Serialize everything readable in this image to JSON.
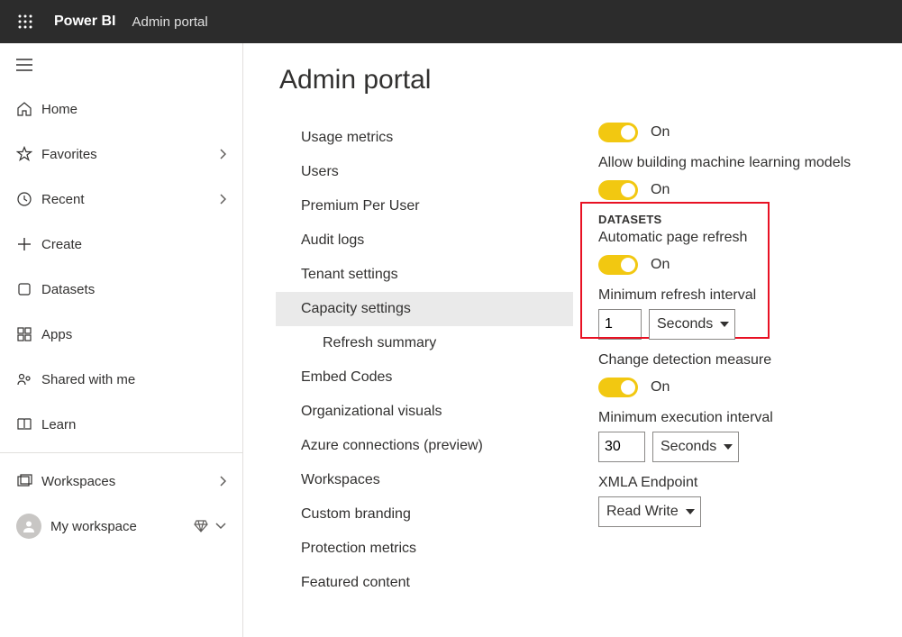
{
  "topbar": {
    "brand": "Power BI",
    "portal": "Admin portal"
  },
  "sidebar": {
    "items": [
      {
        "label": "Home"
      },
      {
        "label": "Favorites"
      },
      {
        "label": "Recent"
      },
      {
        "label": "Create"
      },
      {
        "label": "Datasets"
      },
      {
        "label": "Apps"
      },
      {
        "label": "Shared with me"
      },
      {
        "label": "Learn"
      }
    ],
    "workspaces": "Workspaces",
    "my_workspace": "My workspace"
  },
  "page": {
    "title": "Admin portal"
  },
  "admin_menu": {
    "items": [
      "Usage metrics",
      "Users",
      "Premium Per User",
      "Audit logs",
      "Tenant settings",
      "Capacity settings",
      "Refresh summary",
      "Embed Codes",
      "Organizational visuals",
      "Azure connections (preview)",
      "Workspaces",
      "Custom branding",
      "Protection metrics",
      "Featured content"
    ],
    "selected_index": 5,
    "sub_index": 6
  },
  "settings": {
    "row1_state": "On",
    "allow_ml_label": "Allow building machine learning models",
    "row2_state": "On",
    "section_datasets": "DATASETS",
    "auto_refresh_label": "Automatic page refresh",
    "auto_refresh_state": "On",
    "min_refresh_label": "Minimum refresh interval",
    "min_refresh_value": "1",
    "min_refresh_unit": "Seconds",
    "change_detect_label": "Change detection measure",
    "change_detect_state": "On",
    "min_exec_label": "Minimum execution interval",
    "min_exec_value": "30",
    "min_exec_unit": "Seconds",
    "xmla_label": "XMLA Endpoint",
    "xmla_value": "Read Write"
  }
}
